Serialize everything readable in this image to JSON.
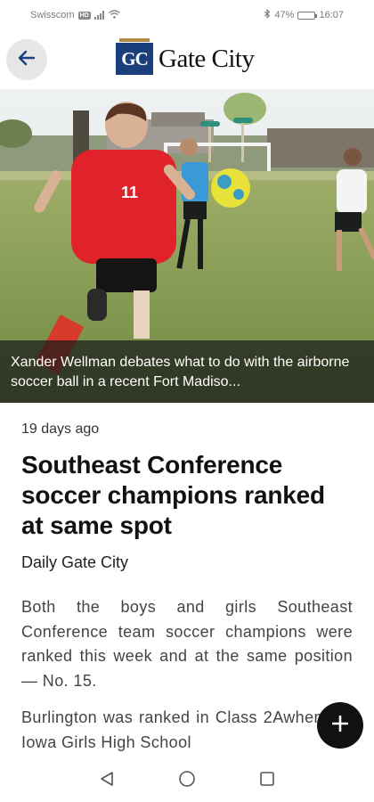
{
  "status_bar": {
    "carrier": "Swisscom",
    "carrier_badge": "HD",
    "battery_text": "47%",
    "battery_level": 0.47,
    "time": "16:07"
  },
  "header": {
    "logo_mark": "GC",
    "logo_text": "Gate City",
    "back_icon": "arrow-left-icon"
  },
  "hero": {
    "caption": "Xander Wellman debates what to do with the airborne soccer ball in a recent Fort Madiso..."
  },
  "article": {
    "timestamp": "19 days ago",
    "headline": "Southeast Conference soccer champions ranked at same spot",
    "source": "Daily Gate City",
    "paragraphs": [
      "Both the boys and girls Southeast Conference team soccer champions were ranked this week and at the same position — No. 15.",
      "Burlington was ranked in Class 2Awhen the Iowa Girls High School"
    ]
  },
  "fab": {
    "icon": "plus-icon"
  },
  "nav": {
    "back": "back-triangle-icon",
    "home": "home-circle-icon",
    "recents": "recents-square-icon"
  }
}
